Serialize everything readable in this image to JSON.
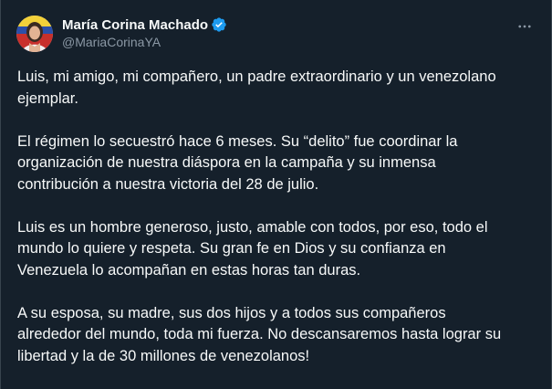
{
  "author": {
    "display_name": "María Corina Machado",
    "handle": "@MariaCorinaYA",
    "verified_badge_color": "#1d9bf0"
  },
  "icons": {
    "verified": "verified-badge-icon",
    "more": "more-options-icon"
  },
  "colors": {
    "background": "#15202b",
    "text_primary": "#f7f9f9",
    "text_secondary": "#8b98a5",
    "accent": "#1d9bf0"
  },
  "tweet": {
    "paragraphs": [
      "Luis, mi amigo, mi compañero, un padre extraordinario y un venezolano\nejemplar.",
      "El régimen lo secuestró hace 6 meses. Su “delito” fue coordinar la\norganización de nuestra diáspora en la campaña y su inmensa\ncontribución a nuestra victoria del 28 de julio.",
      "Luis es un hombre generoso, justo, amable con todos, por eso, todo el\nmundo lo quiere y respeta. Su gran fe en Dios y su confianza en\nVenezuela lo acompañan en estas horas tan duras.",
      "A su esposa, su madre, sus dos hijos y a todos sus compañeros\nalrededor del mundo, toda mi fuerza. No descansaremos hasta lograr su\nlibertad y la de 30 millones de venezolanos!"
    ]
  }
}
